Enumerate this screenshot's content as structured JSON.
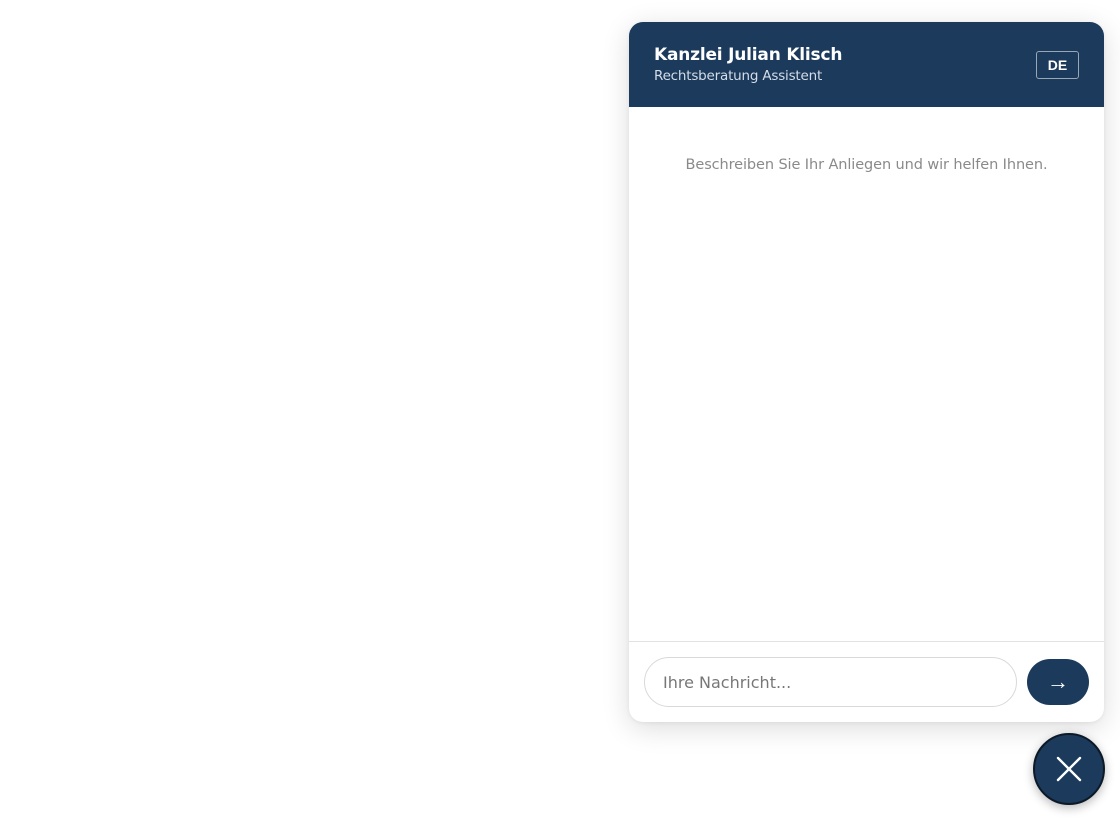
{
  "header": {
    "title": "Kanzlei Julian Klisch",
    "subtitle": "Rechtsberatung Assistent",
    "language_label": "DE"
  },
  "body": {
    "welcome_message": "Beschreiben Sie Ihr Anliegen und wir helfen Ihnen."
  },
  "composer": {
    "placeholder": "Ihre Nachricht...",
    "value": "",
    "send_icon": "arrow-right-icon",
    "send_glyph": "→"
  },
  "launcher": {
    "icon": "close-icon"
  },
  "colors": {
    "brand": "#1b3a5c",
    "background": "#ffffff",
    "muted_text": "#8a8a8a"
  }
}
